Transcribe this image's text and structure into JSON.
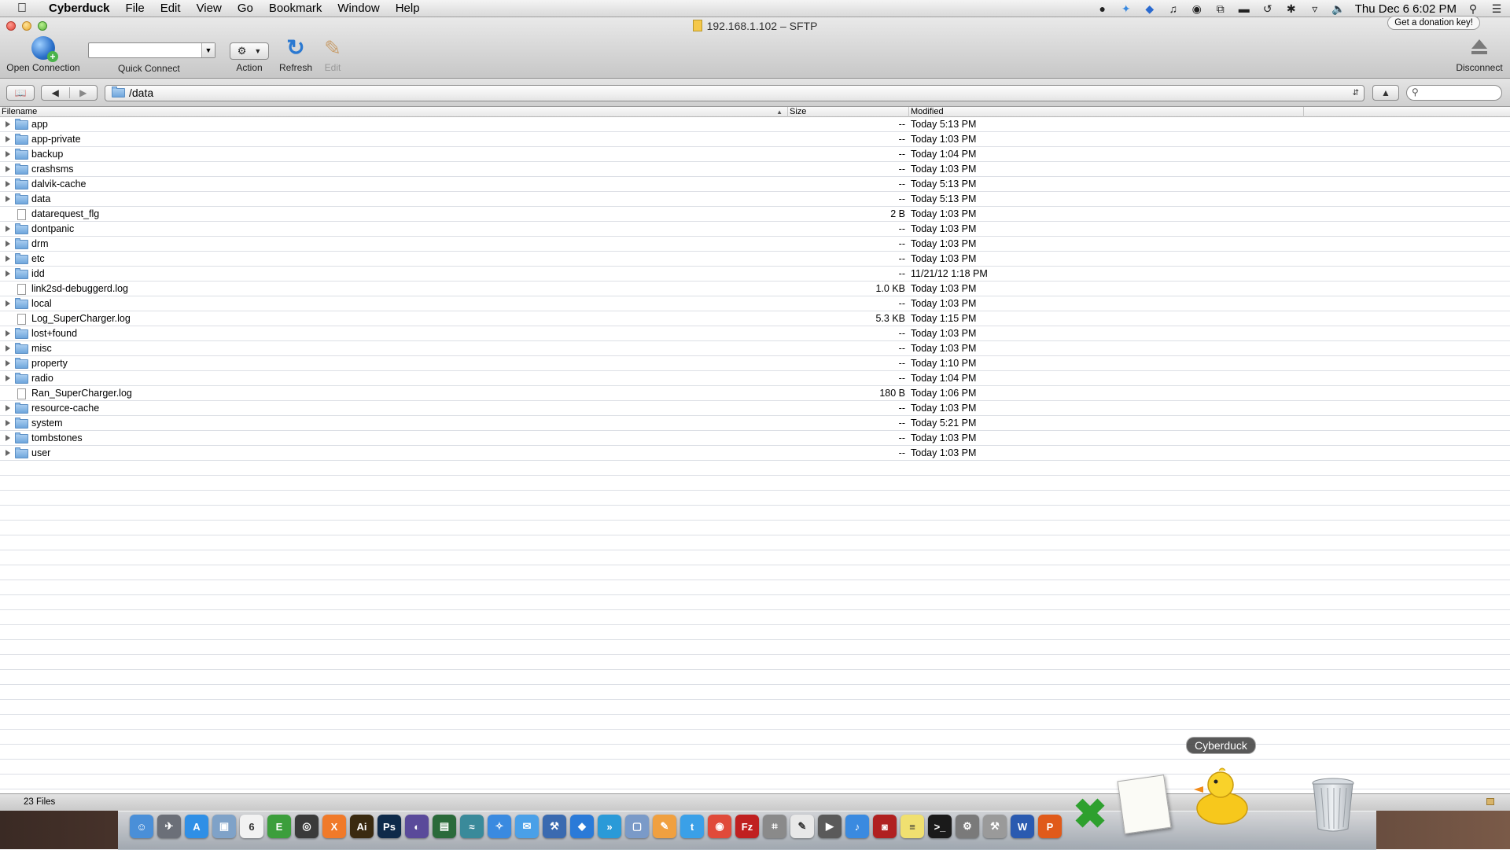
{
  "menubar": {
    "app_name": "Cyberduck",
    "menus": [
      "File",
      "Edit",
      "View",
      "Go",
      "Bookmark",
      "Window",
      "Help"
    ],
    "clock": "Thu Dec 6  6:02 PM",
    "tray_icons": [
      "evernote-icon",
      "twitter-icon",
      "dropbox-icon",
      "music-note-icon",
      "status-icon",
      "window-icon",
      "drive-icon",
      "time-machine-icon",
      "bluetooth-icon",
      "wifi-icon",
      "volume-icon",
      "spotlight-icon",
      "notification-center-icon"
    ]
  },
  "window": {
    "title": "192.168.1.102 – SFTP",
    "donation_label": "Get a donation key!"
  },
  "toolbar": {
    "open_connection": "Open Connection",
    "quick_connect": "Quick Connect",
    "quick_connect_value": "",
    "action": "Action",
    "refresh": "Refresh",
    "edit": "Edit",
    "disconnect": "Disconnect"
  },
  "navbar": {
    "path": "/data",
    "search_placeholder": ""
  },
  "table": {
    "columns": {
      "filename": "Filename",
      "size": "Size",
      "modified": "Modified"
    },
    "rows": [
      {
        "name": "app",
        "type": "folder",
        "size": "--",
        "modified": "Today 5:13 PM"
      },
      {
        "name": "app-private",
        "type": "folder",
        "size": "--",
        "modified": "Today 1:03 PM"
      },
      {
        "name": "backup",
        "type": "folder",
        "size": "--",
        "modified": "Today 1:04 PM"
      },
      {
        "name": "crashsms",
        "type": "folder",
        "size": "--",
        "modified": "Today 1:03 PM"
      },
      {
        "name": "dalvik-cache",
        "type": "folder",
        "size": "--",
        "modified": "Today 5:13 PM"
      },
      {
        "name": "data",
        "type": "folder",
        "size": "--",
        "modified": "Today 5:13 PM"
      },
      {
        "name": "datarequest_flg",
        "type": "file",
        "size": "2 B",
        "modified": "Today 1:03 PM"
      },
      {
        "name": "dontpanic",
        "type": "folder",
        "size": "--",
        "modified": "Today 1:03 PM"
      },
      {
        "name": "drm",
        "type": "folder",
        "size": "--",
        "modified": "Today 1:03 PM"
      },
      {
        "name": "etc",
        "type": "folder",
        "size": "--",
        "modified": "Today 1:03 PM"
      },
      {
        "name": "idd",
        "type": "folder",
        "size": "--",
        "modified": "11/21/12 1:18 PM"
      },
      {
        "name": "link2sd-debuggerd.log",
        "type": "file",
        "size": "1.0 KB",
        "modified": "Today 1:03 PM"
      },
      {
        "name": "local",
        "type": "folder",
        "size": "--",
        "modified": "Today 1:03 PM"
      },
      {
        "name": "Log_SuperCharger.log",
        "type": "file",
        "size": "5.3 KB",
        "modified": "Today 1:15 PM"
      },
      {
        "name": "lost+found",
        "type": "folder",
        "size": "--",
        "modified": "Today 1:03 PM"
      },
      {
        "name": "misc",
        "type": "folder",
        "size": "--",
        "modified": "Today 1:03 PM"
      },
      {
        "name": "property",
        "type": "folder",
        "size": "--",
        "modified": "Today 1:10 PM"
      },
      {
        "name": "radio",
        "type": "folder",
        "size": "--",
        "modified": "Today 1:04 PM"
      },
      {
        "name": "Ran_SuperCharger.log",
        "type": "file",
        "size": "180 B",
        "modified": "Today 1:06 PM"
      },
      {
        "name": "resource-cache",
        "type": "folder",
        "size": "--",
        "modified": "Today 1:03 PM"
      },
      {
        "name": "system",
        "type": "folder",
        "size": "--",
        "modified": "Today 5:21 PM"
      },
      {
        "name": "tombstones",
        "type": "folder",
        "size": "--",
        "modified": "Today 1:03 PM"
      },
      {
        "name": "user",
        "type": "folder",
        "size": "--",
        "modified": "Today 1:03 PM"
      }
    ]
  },
  "status": {
    "file_count": "23 Files"
  },
  "dock": {
    "tooltip": "Cyberduck",
    "icons": [
      {
        "name": "finder-icon",
        "color": "#4a8fd8",
        "glyph": "☺"
      },
      {
        "name": "launchpad-icon",
        "color": "#6b6f78",
        "glyph": "✈"
      },
      {
        "name": "app-store-icon",
        "color": "#2f8fe6",
        "glyph": "A"
      },
      {
        "name": "preview-icon",
        "color": "#7fa2c8",
        "glyph": "▣"
      },
      {
        "name": "calendar-icon",
        "color": "#f2f2f2",
        "glyph": "6"
      },
      {
        "name": "evernote-icon",
        "color": "#3c9e3c",
        "glyph": "E"
      },
      {
        "name": "dvd-player-icon",
        "color": "#3a3a3a",
        "glyph": "◎"
      },
      {
        "name": "xampp-icon",
        "color": "#f07a2a",
        "glyph": "X"
      },
      {
        "name": "illustrator-icon",
        "color": "#3a2a10",
        "glyph": "Ai"
      },
      {
        "name": "photoshop-icon",
        "color": "#0e2a4a",
        "glyph": "Ps"
      },
      {
        "name": "eclipse-icon",
        "color": "#5a4a9a",
        "glyph": "◐"
      },
      {
        "name": "activity-monitor-icon",
        "color": "#2a6a3a",
        "glyph": "▤"
      },
      {
        "name": "network-icon",
        "color": "#3a8a9a",
        "glyph": "≈"
      },
      {
        "name": "safari-icon",
        "color": "#3a8ae0",
        "glyph": "✧"
      },
      {
        "name": "messages-icon",
        "color": "#4aa0e8",
        "glyph": "✉"
      },
      {
        "name": "xcode-icon",
        "color": "#3a6ab0",
        "glyph": "⚒"
      },
      {
        "name": "dropbox-icon",
        "color": "#2a7ad8",
        "glyph": "◆"
      },
      {
        "name": "forward-icon",
        "color": "#2a9ad8",
        "glyph": "»"
      },
      {
        "name": "box-icon",
        "color": "#7a9ac8",
        "glyph": "▢"
      },
      {
        "name": "pages-icon",
        "color": "#f0a040",
        "glyph": "✎"
      },
      {
        "name": "twitter-icon",
        "color": "#3aa0e8",
        "glyph": "t"
      },
      {
        "name": "chrome-icon",
        "color": "#e04a3a",
        "glyph": "◉"
      },
      {
        "name": "filezilla-icon",
        "color": "#c02020",
        "glyph": "Fz"
      },
      {
        "name": "calculator-icon",
        "color": "#8a8a8a",
        "glyph": "⌗"
      },
      {
        "name": "textedit-icon",
        "color": "#e8e8e8",
        "glyph": "✎"
      },
      {
        "name": "facetime-icon",
        "color": "#5a5a5a",
        "glyph": "▶"
      },
      {
        "name": "itunes-icon",
        "color": "#3a8ae0",
        "glyph": "♪"
      },
      {
        "name": "photo-booth-icon",
        "color": "#b02020",
        "glyph": "◙"
      },
      {
        "name": "stickies-icon",
        "color": "#f0e070",
        "glyph": "≡"
      },
      {
        "name": "terminal-icon",
        "color": "#1a1a1a",
        "glyph": ">_"
      },
      {
        "name": "system-preferences-icon",
        "color": "#7a7a7a",
        "glyph": "⚙"
      },
      {
        "name": "utility-icon",
        "color": "#9a9a9a",
        "glyph": "⚒"
      },
      {
        "name": "word-icon",
        "color": "#2a5ab0",
        "glyph": "W"
      },
      {
        "name": "powerpoint-icon",
        "color": "#e05a1a",
        "glyph": "P"
      }
    ]
  }
}
